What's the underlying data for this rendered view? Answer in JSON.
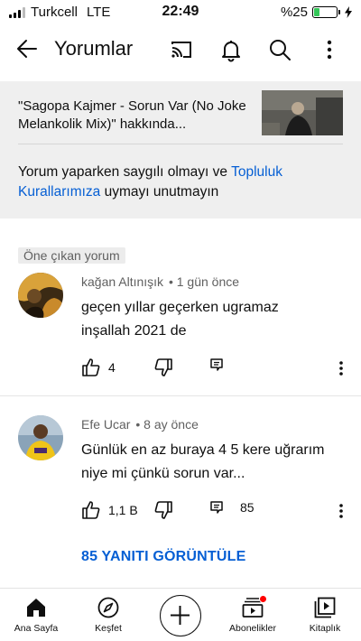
{
  "status_bar": {
    "carrier": "Turkcell",
    "network": "LTE",
    "time": "22:49",
    "battery_text": "%25",
    "battery_level": 0.25,
    "battery_color": "#34c759"
  },
  "header": {
    "title": "Yorumlar",
    "icons": [
      "back-arrow-icon",
      "cast-icon",
      "bell-icon",
      "search-icon",
      "more-vert-icon"
    ]
  },
  "video": {
    "title": "\"Sagopa Kajmer - Sorun Var (No Joke Melankolik Mix)\" hakkında..."
  },
  "guidelines": {
    "before": "Yorum yaparken saygılı olmayı ve ",
    "link": "Topluluk Kurallarımıza",
    "after": " uymayı unutmayın"
  },
  "featured_badge": "Öne çıkan yorum",
  "comments": [
    {
      "author": "kağan Altınışık",
      "time": "• 1 gün önce",
      "text_line1": "geçen yıllar geçerken ugramaz",
      "text_line2": "inşallah 2021 de",
      "likes": "4",
      "replies": ""
    },
    {
      "author": "Efe Ucar",
      "time": "• 8 ay önce",
      "text_line1": "Günlük en az buraya 4 5 kere uğrarım",
      "text_line2": "niye mi çünkü sorun var...",
      "likes": "1,1 B",
      "replies": "85"
    }
  ],
  "view_replies": "85 YANITI GÖRÜNTÜLE",
  "bottom_nav": [
    {
      "label": "Ana Sayfa",
      "icon": "home-icon"
    },
    {
      "label": "Keşfet",
      "icon": "explore-icon"
    },
    {
      "label": "",
      "icon": "add-icon"
    },
    {
      "label": "Abonelikler",
      "icon": "subscriptions-icon"
    },
    {
      "label": "Kitaplık",
      "icon": "library-icon"
    }
  ],
  "colors": {
    "link": "#065fd4",
    "notification_dot": "#ff0000"
  }
}
